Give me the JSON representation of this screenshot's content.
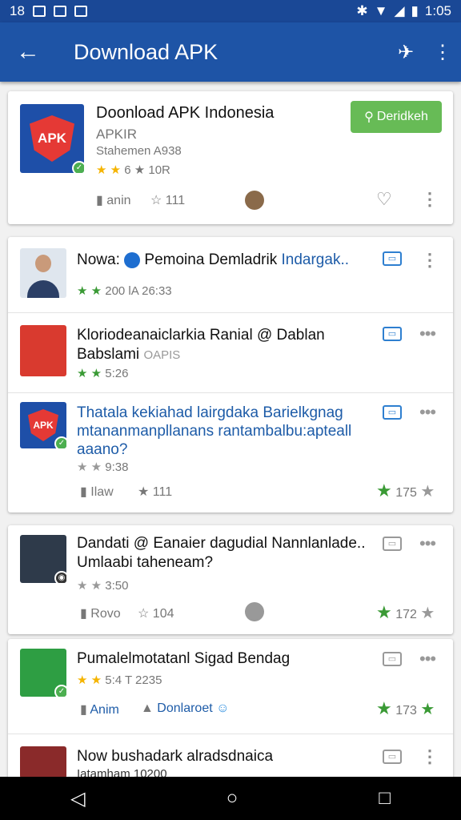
{
  "status_bar": {
    "time": "1:05",
    "left_time": "18"
  },
  "app_bar": {
    "title": "Download APK"
  },
  "featured": {
    "title": "Doonload APK Indonesia",
    "subtitle": "APKIR",
    "meta": "Stahemen A938",
    "rating": "6 ★ 10R",
    "action1": "anin",
    "action2": "111",
    "button_label": "Deridkeh",
    "thumb_text": "APK"
  },
  "feed": [
    {
      "title": "Nowa:",
      "title_rest": "Pemoina Demladrik",
      "title_blue": "Indargak..",
      "meta": "200  lA  26:33"
    },
    {
      "title": "Kloriodeanaiclarkia Ranial @ Dablan",
      "line2": "Babslami",
      "line2_grey": "OAPIS",
      "meta": "5:26"
    },
    {
      "title": "Thatala kekiahad lairgdaka Barielkgnag mtananmanpllanans rantambalbu:apteall aaano?",
      "meta": "9:38",
      "action1": "Ilaw",
      "action2": "111",
      "score": "175"
    },
    {
      "title": "Dandati @ Eanaier dagudial Nannlanlade..",
      "line2": "Umlaabi taheneam?",
      "meta": "3:50",
      "action1": "Rovo",
      "action2": "104",
      "score": "172"
    },
    {
      "title": "Pumalelmotatanl Sigad Bendag",
      "meta": "5:4 T 2235",
      "action1": "Anim",
      "action2": "Donlaroet",
      "score": "173"
    },
    {
      "title": "Now bushadark alradsdnaica",
      "line2": "Iatamham 10200"
    }
  ],
  "colors": {
    "primary": "#1e54a6",
    "accent_green": "#67bb56",
    "star_green": "#3a9a35",
    "star_yellow": "#f5b400",
    "link_blue": "#1e5ca8"
  }
}
